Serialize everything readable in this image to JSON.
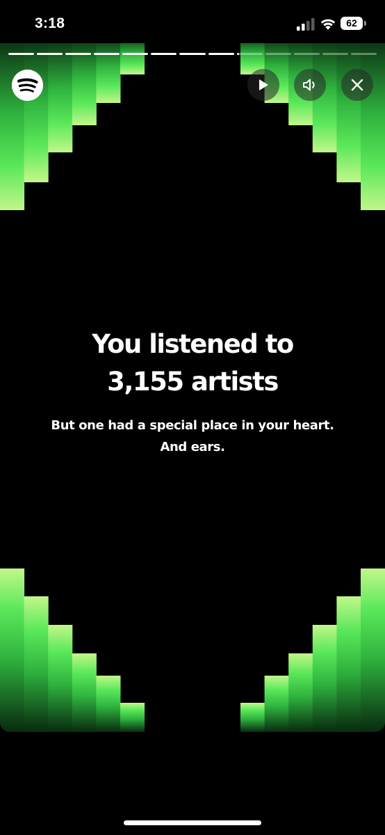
{
  "status_bar": {
    "time": "3:18",
    "battery": "62",
    "icons": [
      "signal-icon",
      "wifi-icon",
      "battery-icon"
    ]
  },
  "story": {
    "progress": {
      "segments": 13,
      "completed": 8,
      "current_fraction": 0.1
    },
    "logo_icon": "spotify-logo-icon",
    "controls": [
      "play-icon",
      "sound-icon",
      "close-icon"
    ],
    "headline_line1": "You listened to",
    "headline_line2": "3,155 artists",
    "subtext_line1": "But one had a special place in your heart.",
    "subtext_line2": "And ears."
  },
  "colors": {
    "background": "#000000",
    "text": "#ffffff",
    "green_bright": "#b8f57c",
    "green_mid": "#3fd14a",
    "green_dark": "#0b3b15"
  }
}
